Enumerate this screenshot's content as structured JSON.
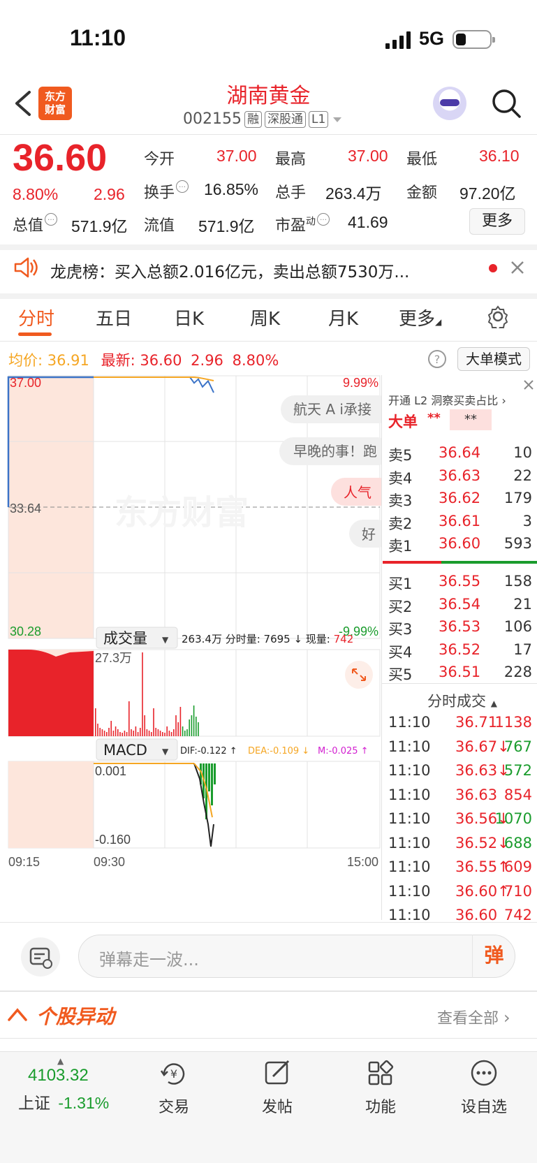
{
  "status": {
    "time": "11:10",
    "network": "5G"
  },
  "header": {
    "logo_line1": "东方",
    "logo_line2": "财富",
    "title": "湖南黄金",
    "code": "002155",
    "tags": [
      "融",
      "深股通",
      "L1"
    ]
  },
  "quote": {
    "price": "36.60",
    "change_pct": "8.80%",
    "change": "2.96",
    "open_label": "今开",
    "open": "37.00",
    "high_label": "最高",
    "high": "37.00",
    "low_label": "最低",
    "low": "36.10",
    "turnover_label": "换手",
    "turnover": "16.85%",
    "vol_label": "总手",
    "vol": "263.4万",
    "amount_label": "金额",
    "amount": "97.20亿",
    "mktcap_label": "总值",
    "mktcap": "571.9亿",
    "float_label": "流值",
    "float": "571.9亿",
    "pe_label": "市盈",
    "pe_sup": "动",
    "pe": "41.69",
    "more": "更多"
  },
  "news": {
    "text": "龙虎榜：买入总额2.016亿元，卖出总额7530万..."
  },
  "tabs": [
    "分时",
    "五日",
    "日K",
    "周K",
    "月K",
    "更多"
  ],
  "chart_info": {
    "avg_label": "均价:",
    "avg": "36.91",
    "latest_label": "最新:",
    "latest": "36.60",
    "latest_chg": "2.96",
    "latest_pct": "8.80%",
    "big_order_mode": "大单模式",
    "y_top": "37.00",
    "y_mid": "33.64",
    "y_bot": "30.28",
    "pct_top": "9.99%",
    "pct_bot": "-9.99%",
    "danmu": [
      "航天 A i承接",
      "早晚的事！跑",
      "人气",
      "好"
    ],
    "watermark": "东方财富",
    "vol_label": "成交量",
    "vol_stats": "263.4万 分时量: 7695 ↓ 现量: ",
    "vol_now": "742",
    "vol_max": "27.3万",
    "macd_label": "MACD",
    "dif": "DIF:-0.122 ↑",
    "dea": "DEA:-0.109 ↓",
    "m": "M:-0.025 ↑",
    "macd_top": "0.001",
    "macd_bot": "-0.160",
    "t_start": "09:15",
    "t_open": "09:30",
    "t_end": "15:00"
  },
  "chart_data": {
    "type": "line",
    "title": "",
    "xlabel": "",
    "ylabel": "",
    "ylim": [
      30.28,
      37.0
    ],
    "x": [
      "09:30",
      "10:30",
      "10:45",
      "10:50",
      "10:55",
      "11:00",
      "11:05",
      "11:10"
    ],
    "series": [
      {
        "name": "",
        "values": [
          37.0,
          37.0,
          37.0,
          36.85,
          36.95,
          36.75,
          36.9,
          36.6
        ]
      },
      {
        "name": "均价",
        "values": [
          37.0,
          37.0,
          37.0,
          37.0,
          36.99,
          36.97,
          36.94,
          36.91
        ]
      }
    ]
  },
  "side": {
    "l2_promo": "开通 L2 洞察买卖占比",
    "big_label": "大单",
    "big_val1": "**",
    "big_val2": "**",
    "asks": [
      {
        "label": "卖5",
        "price": "36.64",
        "vol": "10"
      },
      {
        "label": "卖4",
        "price": "36.63",
        "vol": "22"
      },
      {
        "label": "卖3",
        "price": "36.62",
        "vol": "179"
      },
      {
        "label": "卖2",
        "price": "36.61",
        "vol": "3"
      },
      {
        "label": "卖1",
        "price": "36.60",
        "vol": "593"
      }
    ],
    "bids": [
      {
        "label": "买1",
        "price": "36.55",
        "vol": "158"
      },
      {
        "label": "买2",
        "price": "36.54",
        "vol": "21"
      },
      {
        "label": "买3",
        "price": "36.53",
        "vol": "106"
      },
      {
        "label": "买4",
        "price": "36.52",
        "vol": "17"
      },
      {
        "label": "买5",
        "price": "36.51",
        "vol": "228"
      }
    ],
    "trades_title": "分时成交",
    "trades": [
      {
        "time": "11:10",
        "price": "36.71",
        "vol": "1138",
        "color": "#e8232a",
        "vcolor": "#e8232a"
      },
      {
        "time": "11:10",
        "price": "36.67↓",
        "vol": "767",
        "color": "#e8232a",
        "vcolor": "#1a9c2d"
      },
      {
        "time": "11:10",
        "price": "36.63↓",
        "vol": "572",
        "color": "#e8232a",
        "vcolor": "#1a9c2d"
      },
      {
        "time": "11:10",
        "price": "36.63",
        "vol": "854",
        "color": "#e8232a",
        "vcolor": "#e8232a"
      },
      {
        "time": "11:10",
        "price": "36.56↓",
        "vol": "1070",
        "color": "#e8232a",
        "vcolor": "#1a9c2d"
      },
      {
        "time": "11:10",
        "price": "36.52↓",
        "vol": "688",
        "color": "#e8232a",
        "vcolor": "#1a9c2d"
      },
      {
        "time": "11:10",
        "price": "36.55↑",
        "vol": "609",
        "color": "#e8232a",
        "vcolor": "#e8232a"
      },
      {
        "time": "11:10",
        "price": "36.60↑",
        "vol": "710",
        "color": "#e8232a",
        "vcolor": "#e8232a"
      },
      {
        "time": "11:10",
        "price": "36.60",
        "vol": "742",
        "color": "#e8232a",
        "vcolor": "#e8232a"
      }
    ]
  },
  "danmu_bar": {
    "placeholder": "弹幕走一波...",
    "send": "弹"
  },
  "section": {
    "title": "个股异动",
    "all": "查看全部"
  },
  "tabbar": {
    "index_value": "4103.32",
    "index_name": "上证",
    "index_pct": "-1.31%",
    "items": [
      "交易",
      "发帖",
      "功能",
      "设自选"
    ]
  },
  "colors": {
    "up": "#e8232a",
    "down": "#1a9c2d",
    "accent": "#f05a1f",
    "avg": "#f5a623",
    "price_line": "#3b73c7"
  }
}
